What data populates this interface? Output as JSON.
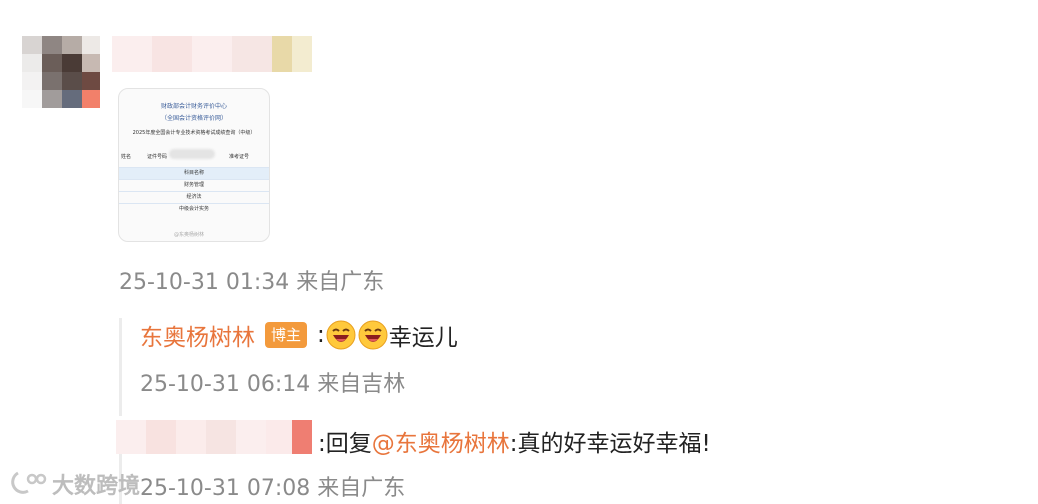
{
  "post": {
    "image_doc": {
      "line1": "财政部会计财务评价中心",
      "line2": "（全国会计资格评价网）",
      "line3": "2025年度全国会计专业技术资格考试成绩查询（中级）",
      "label_left": "姓名",
      "label_mid": "证件号码",
      "label_right": "准考证号",
      "table_header": [
        "科目名称"
      ],
      "table_rows": [
        "财务管理",
        "经济法",
        "中级会计实务"
      ],
      "watermark": "@东奥杨树林"
    },
    "timestamp": "25-10-31 01:34 来自广东"
  },
  "replies": [
    {
      "username": "东奥杨树林",
      "badge": "博主",
      "sep": ":",
      "text": "幸运儿",
      "timestamp": "25-10-31 06:14 来自吉林"
    },
    {
      "prefix": ":回复",
      "mention": "@东奥杨树林",
      "text": ":真的好幸运好幸福!",
      "timestamp": "25-10-31 07:08 来自广东"
    }
  ],
  "watermark": {
    "text": "大数跨境"
  },
  "colors": {
    "username": "#e8753c",
    "badge_bg": "#f39a3c",
    "timestamp": "#8a8a8a"
  }
}
